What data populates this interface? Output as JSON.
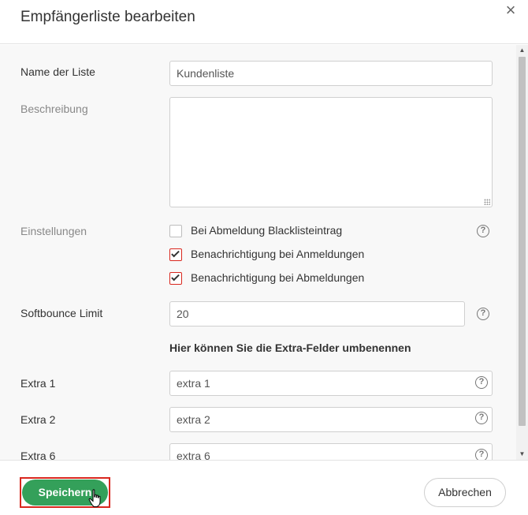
{
  "dialog": {
    "title": "Empfängerliste bearbeiten",
    "close_icon": "×"
  },
  "form": {
    "list_name": {
      "label": "Name der Liste",
      "value": "Kundenliste"
    },
    "description": {
      "label": "Beschreibung",
      "value": ""
    },
    "settings": {
      "label": "Einstellungen",
      "options": [
        {
          "label": "Bei Abmeldung Blacklisteintrag",
          "checked": false
        },
        {
          "label": "Benachrichtigung bei Anmeldungen",
          "checked": true
        },
        {
          "label": "Benachrichtigung bei Abmeldungen",
          "checked": true
        }
      ]
    },
    "softbounce": {
      "label": "Softbounce Limit",
      "value": "20"
    },
    "extra_heading": "Hier können Sie die Extra-Felder umbenennen",
    "extras": [
      {
        "label": "Extra 1",
        "value": "extra 1"
      },
      {
        "label": "Extra 2",
        "value": "extra 2"
      },
      {
        "label": "Extra 6",
        "value": "extra 6"
      }
    ],
    "help_icon": "?"
  },
  "footer": {
    "save_label": "Speichern",
    "cancel_label": "Abbrechen"
  },
  "scrollbar": {
    "up": "▲",
    "down": "▼"
  },
  "colors": {
    "accent_green": "#34a05a",
    "highlight_red": "#d9271e",
    "body_bg": "#f8f8f8"
  }
}
